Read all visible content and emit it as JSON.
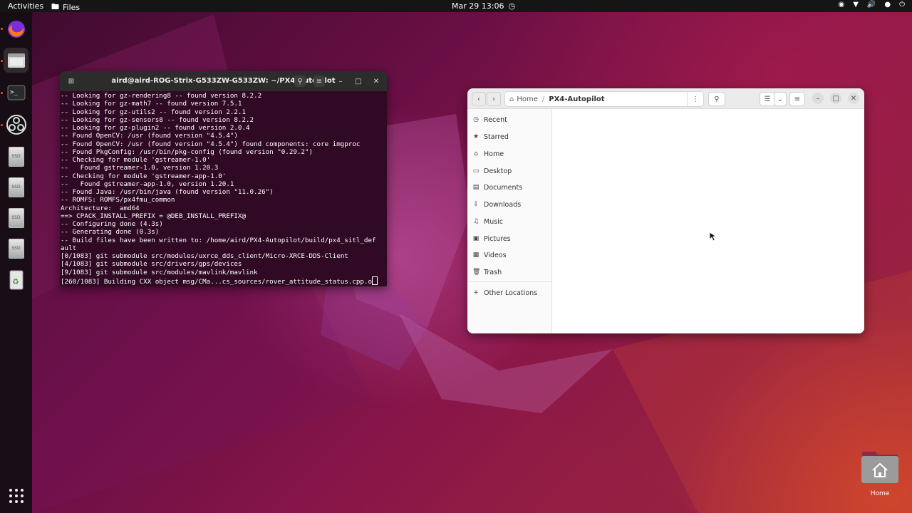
{
  "topbar": {
    "activities": "Activities",
    "app_menu": "Files",
    "clock": "Mar 29  13:06"
  },
  "dock": {
    "items": [
      "firefox-icon",
      "files-icon",
      "terminal-icon",
      "obs-icon",
      "drive-icon",
      "drive-icon",
      "drive-icon",
      "drive-icon",
      "trash-icon"
    ],
    "drive_label": "SSD",
    "show_apps": "show-applications-icon"
  },
  "terminal": {
    "title": "aird@aird-ROG-Strix-G533ZW-G533ZW: ~/PX4-Autopilot",
    "lines": [
      "-- Looking for gz-rendering8 -- found version 8.2.2",
      "-- Looking for gz-math7 -- found version 7.5.1",
      "-- Looking for gz-utils2 -- found version 2.2.1",
      "-- Looking for gz-sensors8 -- found version 8.2.2",
      "-- Looking for gz-plugin2 -- found version 2.0.4",
      "-- Found OpenCV: /usr (found version \"4.5.4\")",
      "-- Found OpenCV: /usr (found version \"4.5.4\") found components: core imgproc",
      "-- Found PkgConfig: /usr/bin/pkg-config (found version \"0.29.2\")",
      "-- Checking for module 'gstreamer-1.0'",
      "--   Found gstreamer-1.0, version 1.20.3",
      "-- Checking for module 'gstreamer-app-1.0'",
      "--   Found gstreamer-app-1.0, version 1.20.1",
      "-- Found Java: /usr/bin/java (found version \"11.0.26\")",
      "-- ROMFS: ROMFS/px4fmu_common",
      "Architecture:  amd64",
      "==> CPACK_INSTALL_PREFIX = @DEB_INSTALL_PREFIX@",
      "-- Configuring done (4.3s)",
      "-- Generating done (0.3s)",
      "-- Build files have been written to: /home/aird/PX4-Autopilot/build/px4_sitl_def",
      "ault",
      "[0/1083] git submodule src/modules/uxrce_dds_client/Micro-XRCE-DDS-Client",
      "[4/1083] git submodule src/drivers/gps/devices",
      "[9/1083] git submodule src/modules/mavlink/mavlink",
      "[260/1083] Building CXX object msg/CMa...cs_sources/rover_attitude_status.cpp.o"
    ]
  },
  "files": {
    "path": [
      "Home",
      "/",
      "PX4-Autopilot"
    ],
    "sidebar": [
      {
        "label": "Recent",
        "icon": "clock-icon"
      },
      {
        "label": "Starred",
        "icon": "star-icon"
      },
      {
        "label": "Home",
        "icon": "home-icon"
      },
      {
        "label": "Desktop",
        "icon": "desktop-icon"
      },
      {
        "label": "Documents",
        "icon": "document-icon"
      },
      {
        "label": "Downloads",
        "icon": "download-icon"
      },
      {
        "label": "Music",
        "icon": "music-icon"
      },
      {
        "label": "Pictures",
        "icon": "pictures-icon"
      },
      {
        "label": "Videos",
        "icon": "videos-icon"
      },
      {
        "label": "Trash",
        "icon": "trash-icon"
      },
      {
        "label": "Other Locations",
        "icon": "plus-icon"
      }
    ]
  },
  "desktop": {
    "home_label": "Home"
  }
}
